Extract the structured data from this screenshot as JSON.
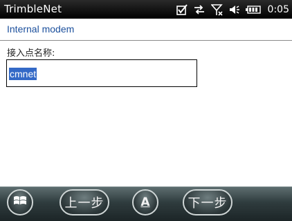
{
  "status_bar": {
    "app_title": "TrimbleNet",
    "time": "0:05",
    "icons": [
      "checkbox-icon",
      "sync-arrows-icon",
      "no-signal-icon",
      "speaker-icon",
      "battery-icon"
    ]
  },
  "header": {
    "title": "Internal modem"
  },
  "form": {
    "apn_label": "接入点名称:",
    "apn_value": "cmnet"
  },
  "taskbar": {
    "back_label": "上一步",
    "input_label": "A",
    "next_label": "下一步"
  },
  "colors": {
    "header_text": "#1b4f9c",
    "selection": "#3369c7",
    "status_bg": "#000000"
  }
}
